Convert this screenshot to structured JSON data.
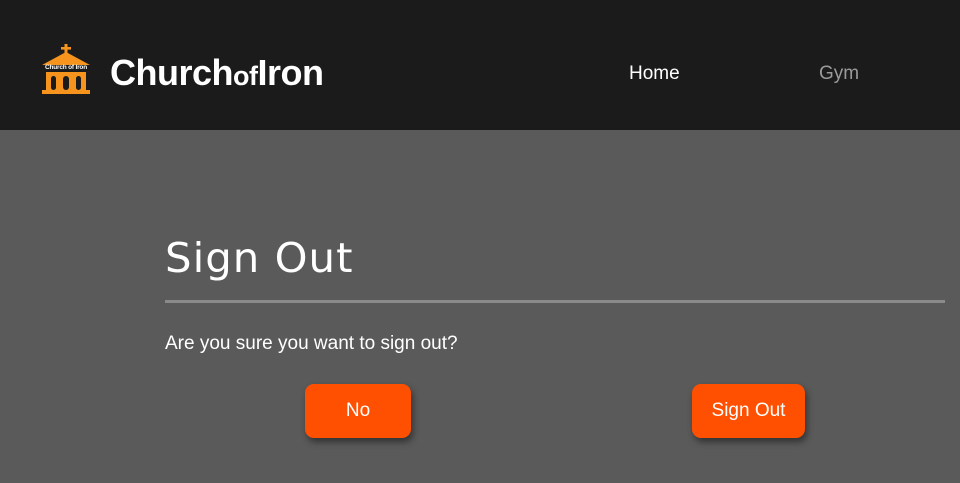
{
  "brand": {
    "logo_text": "Church of Iron",
    "name_part1": "Church",
    "name_part2": "of",
    "name_part3": "Iron"
  },
  "nav": {
    "home_label": "Home",
    "gym_label": "Gym"
  },
  "signout": {
    "title": "Sign Out",
    "question": "Are you sure you want to sign out?",
    "no_label": "No",
    "confirm_label": "Sign Out"
  },
  "colors": {
    "navbar_bg": "#1b1b1b",
    "page_bg": "#5a5a5a",
    "accent": "#ff4f00",
    "logo_orange": "#f7941d",
    "inactive_link": "#9a9a9a"
  },
  "icons": {
    "logo": "church-icon"
  }
}
